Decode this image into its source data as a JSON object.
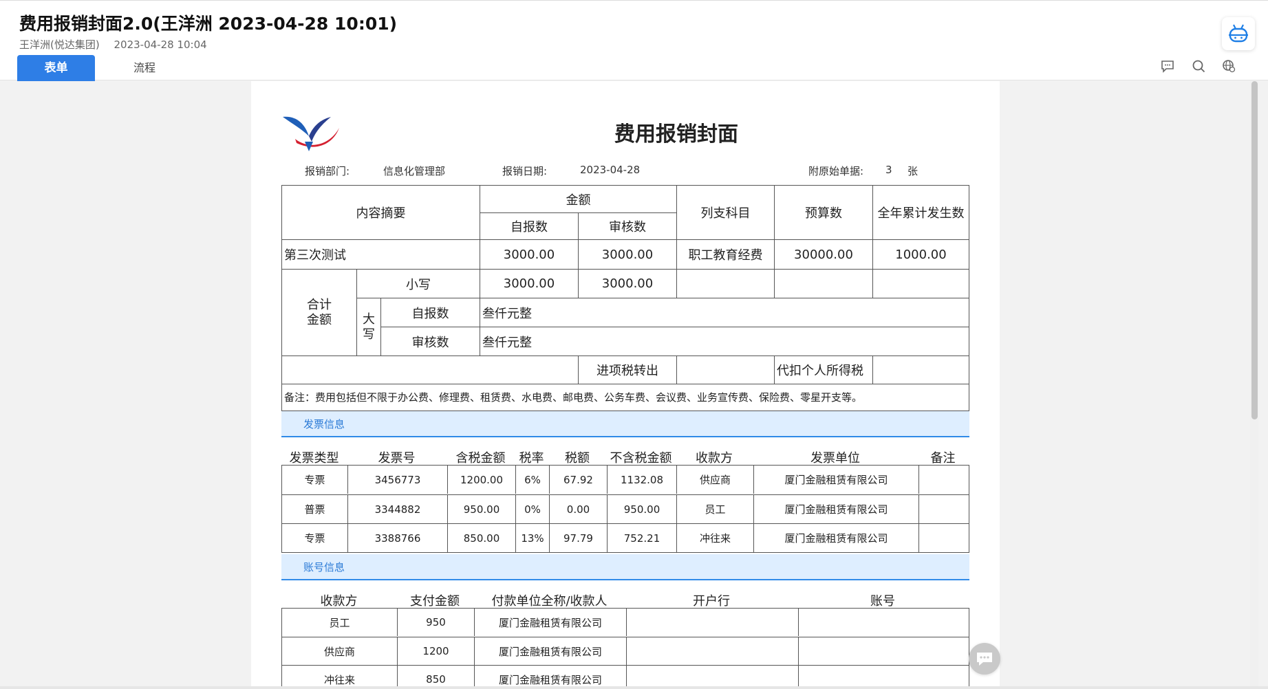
{
  "window": {
    "title": "费用报销封面2.0(王洋洲 2023-04-28 10:01)",
    "author": "王洋洲(悦达集团)",
    "timestamp": "2023-04-28 10:04"
  },
  "tabs": {
    "form": "表单",
    "flow": "流程"
  },
  "toolbar_icons": [
    "comment-icon",
    "search-icon",
    "globe-settings-icon"
  ],
  "doc": {
    "title": "费用报销封面",
    "dept_label": "报销部门:",
    "dept_value": "信息化管理部",
    "date_label": "报销日期:",
    "date_value": "2023-04-28",
    "attach_label": "附原始单据:",
    "attach_value": "3",
    "attach_unit": "张"
  },
  "summary": {
    "h_content": "内容摘要",
    "h_amount": "金额",
    "h_self": "自报数",
    "h_audit": "审核数",
    "h_subject": "列支科目",
    "h_budget": "预算数",
    "h_yearly": "全年累计发生数",
    "row1": {
      "content": "第三次测试",
      "self": "3000.00",
      "audit": "3000.00",
      "subject": "职工教育经费",
      "budget": "30000.00",
      "yearly": "1000.00"
    },
    "total_label_1": "合计",
    "total_label_2": "金额",
    "small_label": "小写",
    "small_self": "3000.00",
    "small_audit": "3000.00",
    "big_label_1": "大",
    "big_label_2": "写",
    "big_self_label": "自报数",
    "big_self_value": "叁仟元整",
    "big_audit_label": "审核数",
    "big_audit_value": "叁仟元整",
    "tax_out_label": "进项税转出",
    "tax_personal_label": "代扣个人所得税",
    "note": "备注：费用包括但不限于办公费、修理费、租赁费、水电费、邮电费、公务车费、会议费、业务宣传费、保险费、零星开支等。"
  },
  "invoice": {
    "section_title": "发票信息",
    "headers": [
      "发票类型",
      "发票号",
      "含税金额",
      "税率",
      "税额",
      "不含税金额",
      "收款方",
      "发票单位",
      "备注"
    ],
    "rows": [
      [
        "专票",
        "3456773",
        "1200.00",
        "6%",
        "67.92",
        "1132.08",
        "供应商",
        "厦门金融租赁有限公司",
        ""
      ],
      [
        "普票",
        "3344882",
        "950.00",
        "0%",
        "0.00",
        "950.00",
        "员工",
        "厦门金融租赁有限公司",
        ""
      ],
      [
        "专票",
        "3388766",
        "850.00",
        "13%",
        "97.79",
        "752.21",
        "冲往来",
        "厦门金融租赁有限公司",
        ""
      ]
    ]
  },
  "account": {
    "section_title": "账号信息",
    "headers": [
      "收款方",
      "支付金额",
      "付款单位全称/收款人",
      "开户行",
      "账号"
    ],
    "rows": [
      [
        "员工",
        "950",
        "厦门金融租赁有限公司",
        "",
        ""
      ],
      [
        "供应商",
        "1200",
        "厦门金融租赁有限公司",
        "",
        ""
      ],
      [
        "冲往来",
        "850",
        "厦门金融租赁有限公司",
        "",
        ""
      ]
    ]
  },
  "colors": {
    "accent": "#2e7ee6",
    "section_bg": "#deeeff",
    "section_text": "#2a7ad6"
  }
}
